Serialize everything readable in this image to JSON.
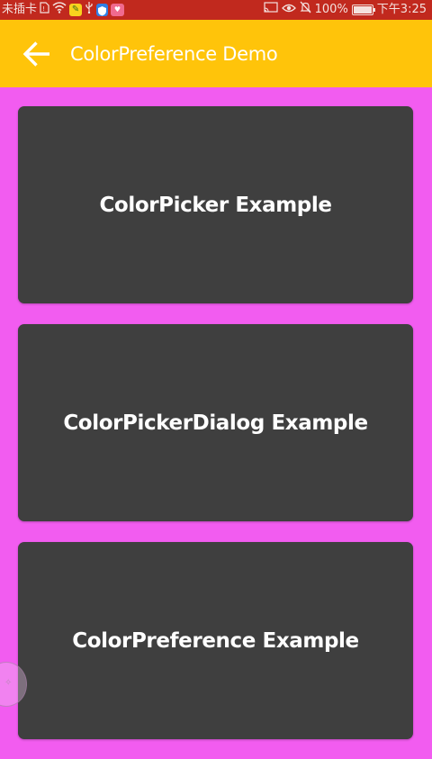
{
  "status_bar": {
    "carrier": "未插卡",
    "battery_text": "100%",
    "time": "下午3:25",
    "battery_level": 1.0,
    "icons": [
      "sim-icon",
      "wifi-icon",
      "app-notification-icon",
      "usb-icon",
      "shield-app-icon",
      "app-icon",
      "cast-icon",
      "eye-icon",
      "mute-icon",
      "battery-icon"
    ]
  },
  "toolbar": {
    "back_icon": "arrow-left-icon",
    "title": "ColorPreference Demo"
  },
  "cards": [
    {
      "label": "ColorPicker Example"
    },
    {
      "label": "ColorPickerDialog Example"
    },
    {
      "label": "ColorPreference Example"
    }
  ],
  "colors": {
    "status_bar": "#C1291E",
    "toolbar": "#FFC40A",
    "background": "#F25CF0",
    "card": "#3F3F3F",
    "text": "#FFFFFF"
  }
}
